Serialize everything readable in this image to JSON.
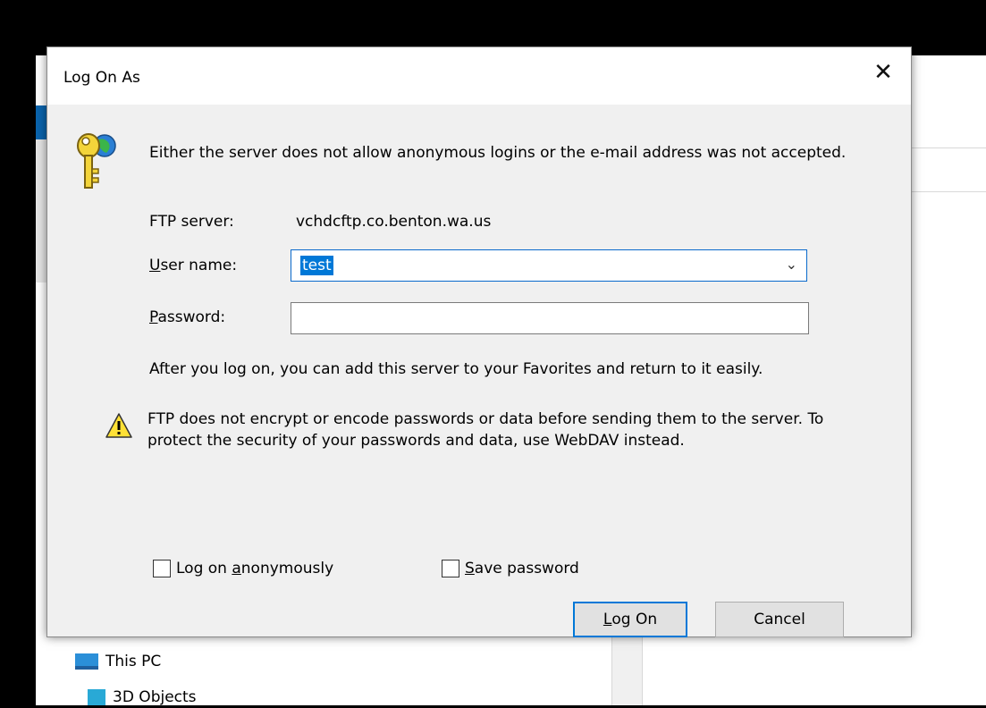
{
  "dialog": {
    "title": "Log On As",
    "close_glyph": "✕",
    "message": "Either the server does not allow anonymous logins or the e-mail address was not accepted.",
    "ftp_server_label": "FTP server:",
    "ftp_server_value": "vchdcftp.co.benton.wa.us",
    "username_label_key": "U",
    "username_label_rest": "ser name:",
    "username_value": "test",
    "password_label_key": "P",
    "password_label_rest": "assword:",
    "password_value": "",
    "info": "After you log on, you can add this server to your Favorites and return to it easily.",
    "warning": "FTP does not encrypt or encode passwords or data before sending them to the server.  To protect the security of your passwords and data, use WebDAV instead.",
    "anon_prefix": "Log on ",
    "anon_key": "a",
    "anon_rest": "nonymously",
    "save_key": "S",
    "save_rest": "ave password",
    "logon_key": "L",
    "logon_rest": "og On",
    "cancel_label": "Cancel",
    "anon_checked": false,
    "save_checked": false
  },
  "background": {
    "tree_items": [
      "This PC",
      "3D Objects"
    ]
  },
  "colors": {
    "accent": "#0078d7",
    "dialog_bg": "#f0f0f0",
    "selection": "#0078d7"
  },
  "icons": {
    "key": "key-globe-icon",
    "warning": "warning-icon",
    "dropdown": "chevron-down-icon"
  }
}
